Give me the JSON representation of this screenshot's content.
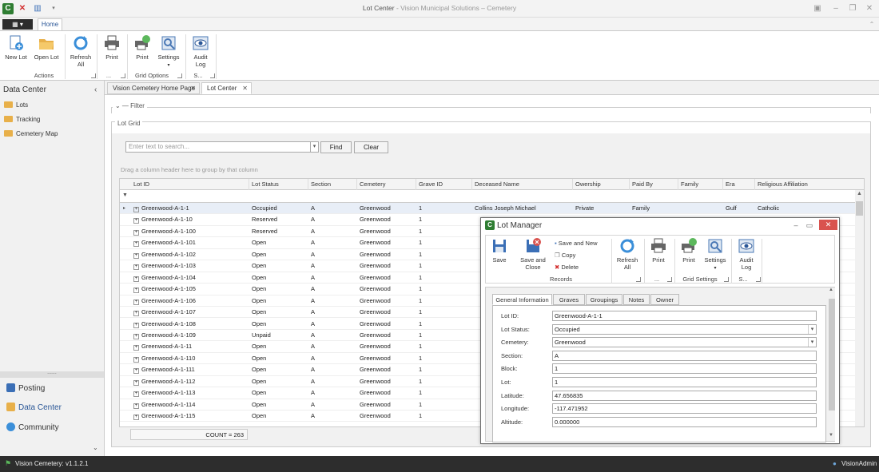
{
  "window": {
    "title": "Lot Center",
    "subtitle": " - Vision Municipal Solutions – Cemetery"
  },
  "ribbon": {
    "home_tab": "Home",
    "new_lot": "New Lot",
    "open_lot": "Open Lot",
    "refresh_all_1": "Refresh",
    "refresh_all_2": "All",
    "print": "Print",
    "grid_print": "Print",
    "settings": "Settings",
    "audit_1": "Audit",
    "audit_2": "Log",
    "group_actions": "Actions",
    "group_dots": "...",
    "group_grid_options": "Grid Options",
    "group_s": "S..."
  },
  "left_pane": {
    "header": "Data Center",
    "items": [
      "Lots",
      "Tracking",
      "Cemetery Map"
    ],
    "splitter": "......",
    "nav": [
      "Posting",
      "Data Center",
      "Community"
    ]
  },
  "doc_tabs": [
    "Vision Cemetery Home Page",
    "Lot Center"
  ],
  "filter": {
    "label": "Filter",
    "chevron": "⌄"
  },
  "lot_grid": {
    "label": "Lot Grid",
    "search_placeholder": "Enter text to search...",
    "find": "Find",
    "clear": "Clear",
    "group_hint": "Drag a column header here to group by that column",
    "count": "COUNT = 263",
    "columns": [
      "Lot ID",
      "Lot Status",
      "Section",
      "Cemetery",
      "Grave ID",
      "Deceased Name",
      "Owership",
      "Paid By",
      "Family",
      "Era",
      "Religious Affiliation"
    ],
    "rows": [
      [
        "Greenwood-A-1-1",
        "Occupied",
        "A",
        "Greenwood",
        "1",
        "Collins Joseph Michael",
        "Private",
        "Family",
        "",
        "Gulf",
        "Catholic"
      ],
      [
        "Greenwood-A-1-10",
        "Reserved",
        "A",
        "Greenwood",
        "1"
      ],
      [
        "Greenwood-A-1-100",
        "Reserved",
        "A",
        "Greenwood",
        "1"
      ],
      [
        "Greenwood-A-1-101",
        "Open",
        "A",
        "Greenwood",
        "1"
      ],
      [
        "Greenwood-A-1-102",
        "Open",
        "A",
        "Greenwood",
        "1"
      ],
      [
        "Greenwood-A-1-103",
        "Open",
        "A",
        "Greenwood",
        "1"
      ],
      [
        "Greenwood-A-1-104",
        "Open",
        "A",
        "Greenwood",
        "1"
      ],
      [
        "Greenwood-A-1-105",
        "Open",
        "A",
        "Greenwood",
        "1"
      ],
      [
        "Greenwood-A-1-106",
        "Open",
        "A",
        "Greenwood",
        "1"
      ],
      [
        "Greenwood-A-1-107",
        "Open",
        "A",
        "Greenwood",
        "1"
      ],
      [
        "Greenwood-A-1-108",
        "Open",
        "A",
        "Greenwood",
        "1"
      ],
      [
        "Greenwood-A-1-109",
        "Unpaid",
        "A",
        "Greenwood",
        "1"
      ],
      [
        "Greenwood-A-1-11",
        "Open",
        "A",
        "Greenwood",
        "1"
      ],
      [
        "Greenwood-A-1-110",
        "Open",
        "A",
        "Greenwood",
        "1"
      ],
      [
        "Greenwood-A-1-111",
        "Open",
        "A",
        "Greenwood",
        "1"
      ],
      [
        "Greenwood-A-1-112",
        "Open",
        "A",
        "Greenwood",
        "1"
      ],
      [
        "Greenwood-A-1-113",
        "Open",
        "A",
        "Greenwood",
        "1"
      ],
      [
        "Greenwood-A-1-114",
        "Open",
        "A",
        "Greenwood",
        "1"
      ],
      [
        "Greenwood-A-1-115",
        "Open",
        "A",
        "Greenwood",
        "1"
      ]
    ]
  },
  "status_bar": {
    "version": "Vision Cemetery: v1.1.2.1",
    "user": "VisionAdmin"
  },
  "lot_manager": {
    "title": "Lot Manager",
    "ribbon": {
      "save": "Save",
      "save_close_1": "Save and",
      "save_close_2": "Close",
      "save_new": "Save and New",
      "copy": "Copy",
      "delete": "Delete",
      "refresh_1": "Refresh",
      "refresh_2": "All",
      "print": "Print",
      "grid_print": "Print",
      "settings": "Settings",
      "audit_1": "Audit",
      "audit_2": "Log",
      "group_records": "Records",
      "group_dots": "...",
      "group_grid_settings": "Grid Settings",
      "group_s": "S..."
    },
    "tabs": [
      "General Information",
      "Graves",
      "Groupings",
      "Notes",
      "Owner"
    ],
    "fields": [
      {
        "label": "Lot ID:",
        "value": "Greenwood-A-1-1",
        "dropdown": false
      },
      {
        "label": "Lot Status:",
        "value": "Occupied",
        "dropdown": true
      },
      {
        "label": "Cemetery:",
        "value": "Greenwood",
        "dropdown": true
      },
      {
        "label": "Section:",
        "value": "A",
        "dropdown": false
      },
      {
        "label": "Block:",
        "value": "1",
        "dropdown": false
      },
      {
        "label": "Lot:",
        "value": "1",
        "dropdown": false
      },
      {
        "label": "Latitude:",
        "value": "47.656835",
        "dropdown": false
      },
      {
        "label": "Longitude:",
        "value": "-117.471952",
        "dropdown": false
      },
      {
        "label": "Altitude:",
        "value": "0.000000",
        "dropdown": false
      }
    ]
  }
}
